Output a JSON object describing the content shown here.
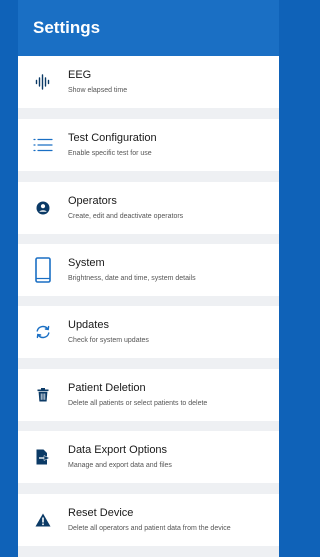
{
  "header": {
    "title": "Settings"
  },
  "colors": {
    "accent": "#1a6fc4",
    "icon": "#0b3a66",
    "background": "#eef0f3"
  },
  "items": [
    {
      "icon": "waveform-icon",
      "label": "EEG",
      "sub": "Show elapsed time"
    },
    {
      "icon": "list-icon",
      "label": "Test  Configuration",
      "sub": "Enable specific test for use"
    },
    {
      "icon": "person-icon",
      "label": "Operators",
      "sub": "Create, edit and deactivate operators"
    },
    {
      "icon": "tablet-icon",
      "label": "System",
      "sub": "Brightness, date and time, system details"
    },
    {
      "icon": "sync-icon",
      "label": "Updates",
      "sub": "Check for system updates"
    },
    {
      "icon": "trash-icon",
      "label": "Patient Deletion",
      "sub": "Delete all patients or select patients to delete"
    },
    {
      "icon": "export-icon",
      "label": "Data Export Options",
      "sub": "Manage and export data and files"
    },
    {
      "icon": "warning-icon",
      "label": "Reset Device",
      "sub": "Delete all operators and patient data from the device"
    }
  ]
}
